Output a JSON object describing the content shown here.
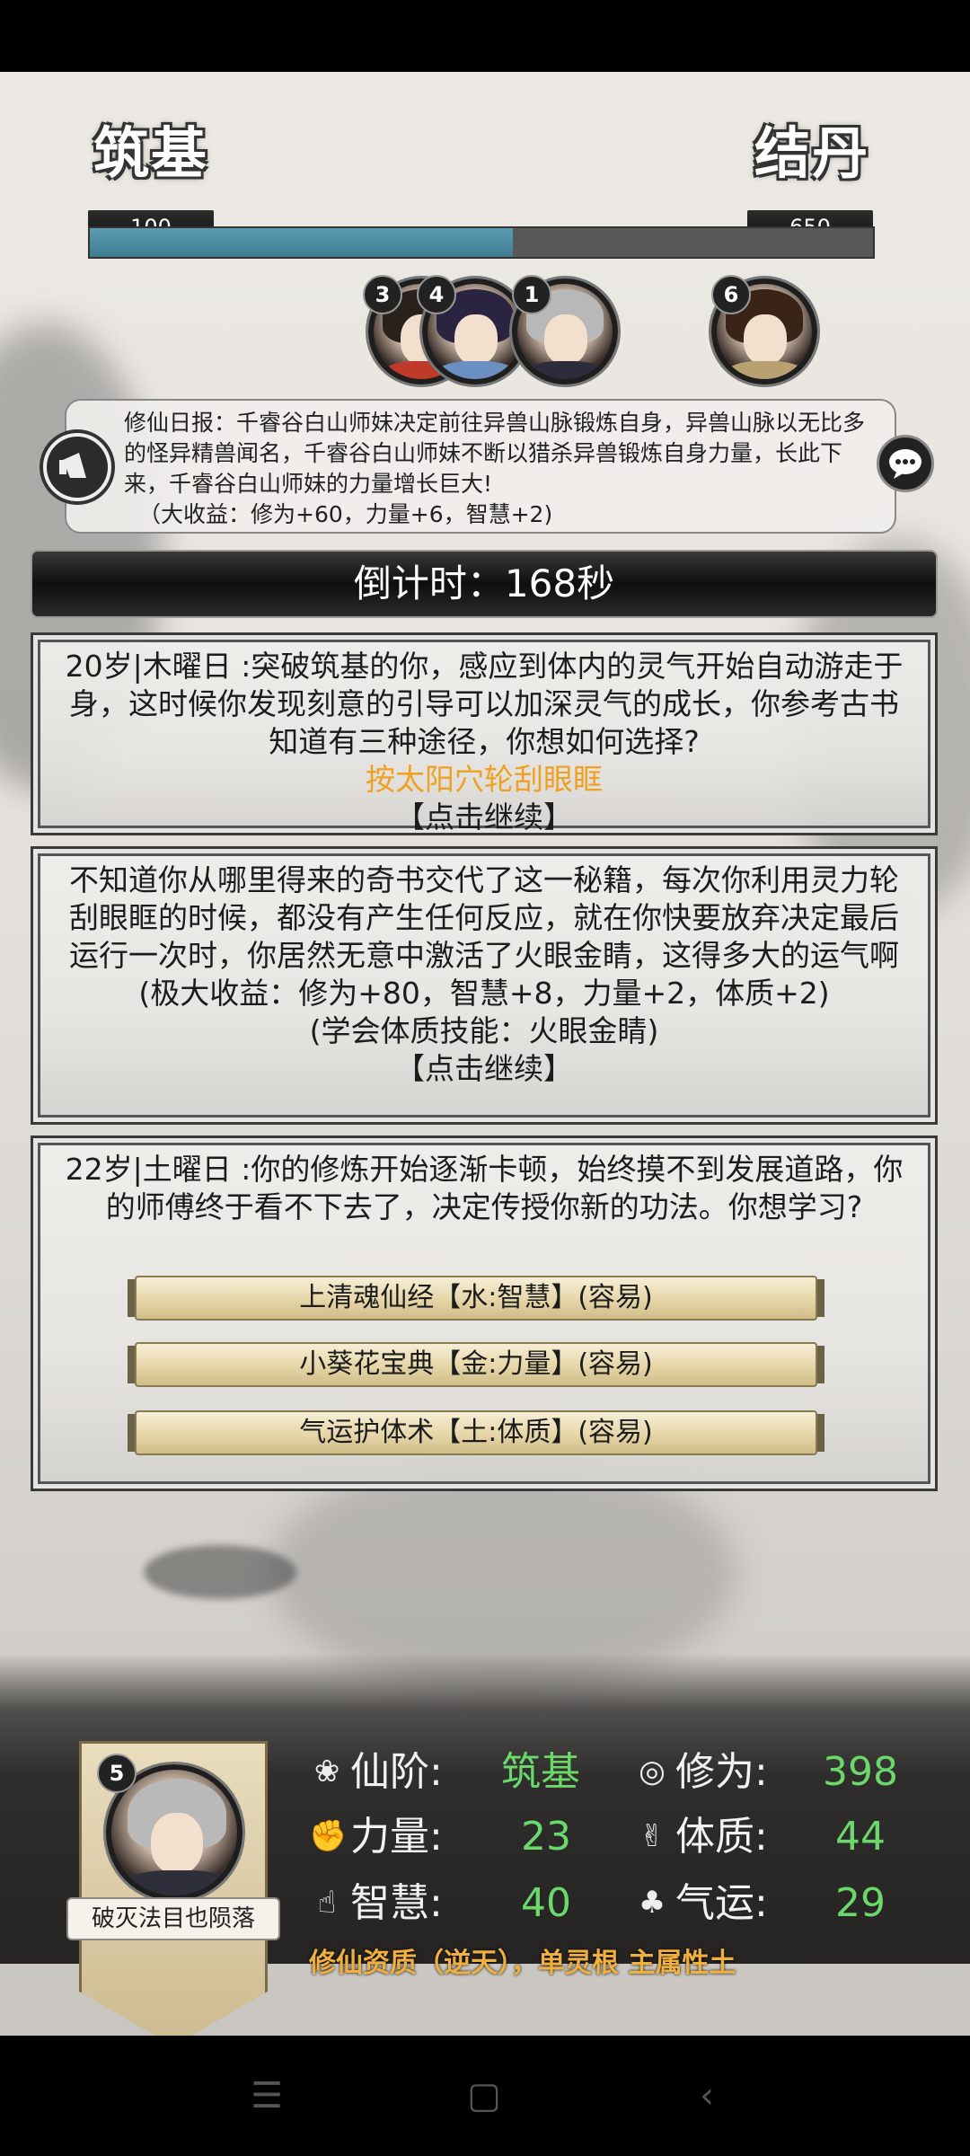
{
  "stages": {
    "current_name": "筑基",
    "current_value": "100",
    "next_name": "结丹",
    "next_value": "650",
    "progress_fraction": 0.54,
    "progress_color": "#4a8aa0"
  },
  "party": [
    {
      "number": "3"
    },
    {
      "number": "4"
    },
    {
      "number": "1"
    },
    {
      "number": "6"
    }
  ],
  "daily_report": {
    "text": "修仙日报：千睿谷白山师妹决定前往异兽山脉锻炼自身，异兽山脉以无比多的怪异精兽闻名，千睿谷白山师妹不断以猎杀异兽锻炼自身力量，长此下来，千睿谷白山师妹的力量增长巨大!",
    "gain": "（大收益：修为+60，力量+6，智慧+2)",
    "icon": "horn-icon",
    "chat_icon": "chat-bubble-icon"
  },
  "countdown": "倒计时：168秒",
  "events": [
    {
      "text": "20岁|木曜日 :突破筑基的你，感应到体内的灵气开始自动游走于身，这时候你发现刻意的引导可以加深灵气的成长，你参考古书知道有三种途径，你想如何选择?",
      "choice": "按太阳穴轮刮眼眶",
      "continue": "【点击继续】"
    },
    {
      "text": "不知道你从哪里得来的奇书交代了这一秘籍，每次你利用灵力轮刮眼眶的时候，都没有产生任何反应，就在你快要放弃决定最后运行一次时，你居然无意中激活了火眼金睛，这得多大的运气啊",
      "gain": "(极大收益：修为+80，智慧+8，力量+2，体质+2)",
      "skill": "(学会体质技能：火眼金睛)",
      "continue": "【点击继续】"
    },
    {
      "text": "22岁|土曜日 :你的修炼开始逐渐卡顿，始终摸不到发展道路，你的师傅终于看不下去了，决定传授你新的功法。你想学习?",
      "options": [
        "上清魂仙经【水:智慧】(容易)",
        "小葵花宝典【金:力量】(容易)",
        "气运护体术【土:体质】(容易)"
      ]
    }
  ],
  "player": {
    "badge": "5",
    "title": "破灭法目也陨落",
    "stats": {
      "realm_label": "仙阶:",
      "realm_value": "筑基",
      "cultivation_label": "修为:",
      "cultivation_value": "398",
      "strength_label": "力量:",
      "strength_value": "23",
      "constitution_label": "体质:",
      "constitution_value": "44",
      "wisdom_label": "智慧:",
      "wisdom_value": "40",
      "luck_label": "气运:",
      "luck_value": "29"
    },
    "aptitude": "修仙资质（逆天），单灵根 主属性土",
    "value_color": "#6bd86b"
  },
  "navbar": {
    "menu_icon": "☰",
    "home_icon": "▢",
    "back_icon": "‹"
  }
}
